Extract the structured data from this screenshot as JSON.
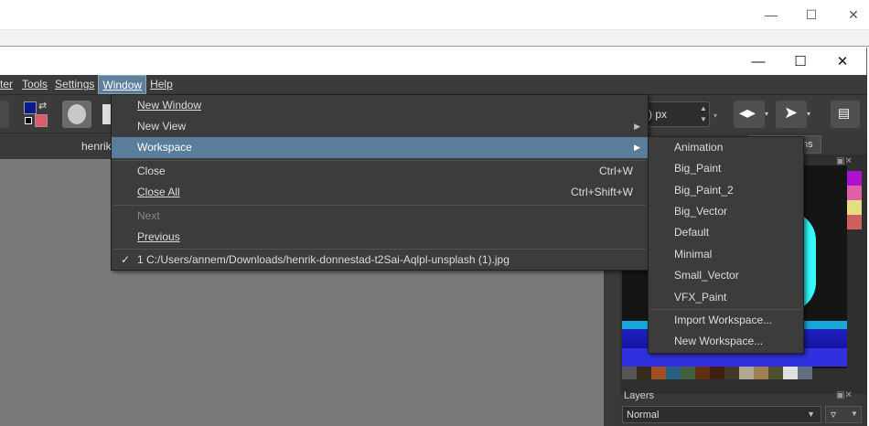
{
  "menubar": {
    "items": [
      {
        "label": "ter"
      },
      {
        "label": "Tools"
      },
      {
        "label": "Settings"
      },
      {
        "label": "Window"
      },
      {
        "label": "Help"
      }
    ]
  },
  "toolbar": {
    "size_value": ") px"
  },
  "document_tab": {
    "label": "henrik"
  },
  "dock": {
    "tab_fragment": "ns",
    "layers_title": "Layers",
    "blend_mode": "Normal"
  },
  "window_menu": {
    "items": [
      {
        "label": "New Window",
        "shortcut": ""
      },
      {
        "label": "New View",
        "shortcut": ""
      },
      {
        "label": "Workspace",
        "shortcut": ""
      },
      {
        "label": "Close",
        "shortcut": "Ctrl+W"
      },
      {
        "label": "Close All",
        "shortcut": "Ctrl+Shift+W"
      },
      {
        "label": "Next",
        "shortcut": ""
      },
      {
        "label": "Previous",
        "shortcut": ""
      },
      {
        "label": "1 C:/Users/annem/Downloads/henrik-donnestad-t2Sai-Aqlpl-unsplash (1).jpg",
        "shortcut": ""
      }
    ]
  },
  "workspace_menu": {
    "items": [
      {
        "label": "Animation"
      },
      {
        "label": "Big_Paint"
      },
      {
        "label": "Big_Paint_2"
      },
      {
        "label": "Big_Vector"
      },
      {
        "label": "Default"
      },
      {
        "label": "Minimal"
      },
      {
        "label": "Small_Vector"
      },
      {
        "label": "VFX_Paint"
      },
      {
        "label": "Import Workspace..."
      },
      {
        "label": "New Workspace..."
      }
    ]
  },
  "colors": {
    "menu_bg": "#3c3c3c",
    "highlight": "#5a7d9c",
    "canvas": "#7a7a7a"
  }
}
